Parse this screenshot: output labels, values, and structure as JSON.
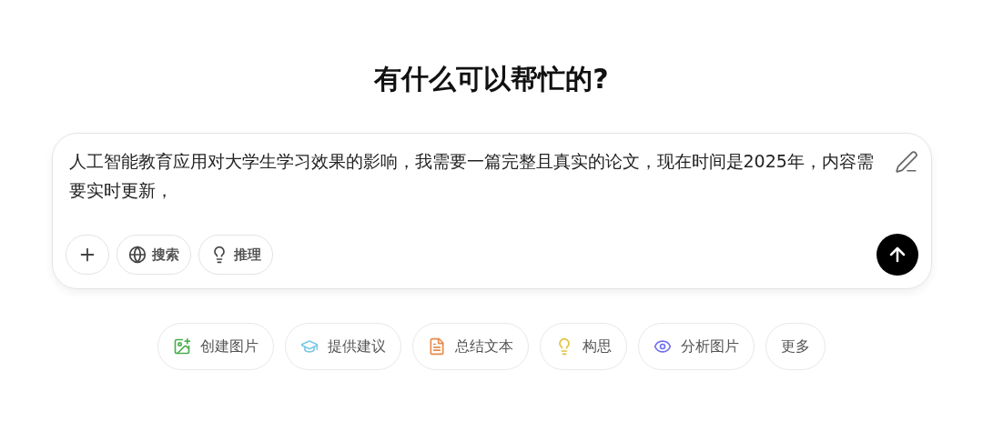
{
  "heading": "有什么可以帮忙的?",
  "composer": {
    "value": "人工智能教育应用对大学生学习效果的影响，我需要一篇完整且真实的论文，现在时间是2025年，内容需要实时更新，",
    "tools": [
      {
        "kind": "plus"
      },
      {
        "kind": "globe",
        "label": "搜索"
      },
      {
        "kind": "bulb",
        "label": "推理"
      }
    ]
  },
  "suggestions": [
    {
      "kind": "image",
      "label": "创建图片",
      "color": "#4caf50"
    },
    {
      "kind": "cap",
      "label": "提供建议",
      "color": "#7cc8e8"
    },
    {
      "kind": "document",
      "label": "总结文本",
      "color": "#e8894a"
    },
    {
      "kind": "bulb",
      "label": "构思",
      "color": "#e2c13c"
    },
    {
      "kind": "eye",
      "label": "分析图片",
      "color": "#6f6ff0"
    },
    {
      "kind": "none",
      "label": "更多"
    }
  ]
}
